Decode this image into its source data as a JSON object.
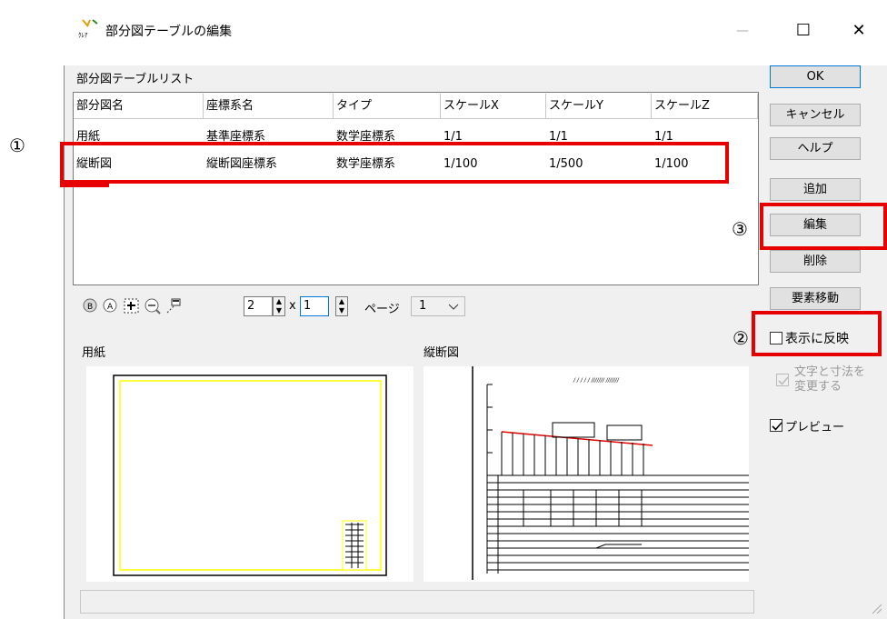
{
  "window": {
    "title": "部分図テーブルの編集",
    "app_icon_text": "ｸﾚｱ",
    "minimize": "—",
    "maximize": "☐",
    "close": "✕"
  },
  "list": {
    "label": "部分図テーブルリスト",
    "columns": [
      "部分図名",
      "座標系名",
      "タイプ",
      "スケールX",
      "スケールY",
      "スケールZ"
    ],
    "rows": [
      [
        "用紙",
        "基準座標系",
        "数学座標系",
        "1/1",
        "1/1",
        "1/1"
      ],
      [
        "縦断図",
        "縦断図座標系",
        "数学座標系",
        "1/100",
        "1/500",
        "1/100"
      ]
    ]
  },
  "buttons": {
    "ok": "OK",
    "cancel": "キャンセル",
    "help": "ヘルプ",
    "add": "追加",
    "edit": "編集",
    "delete": "削除",
    "move": "要素移動"
  },
  "checkboxes": {
    "reflect": "表示に反映",
    "text_dim_line1": "文字と寸法を",
    "text_dim_line2": "変更する",
    "preview": "プレビュー"
  },
  "toolbar": {
    "cols": "2",
    "x_label": "x",
    "rows": "1",
    "page_label": "ページ",
    "page_value": "1"
  },
  "preview": {
    "left_label": "用紙",
    "right_label": "縦断図"
  },
  "annotations": {
    "m1": "①",
    "m2": "②",
    "m3": "③"
  },
  "colors": {
    "highlight": "#e60000",
    "sheet_border": "#ffff00"
  }
}
